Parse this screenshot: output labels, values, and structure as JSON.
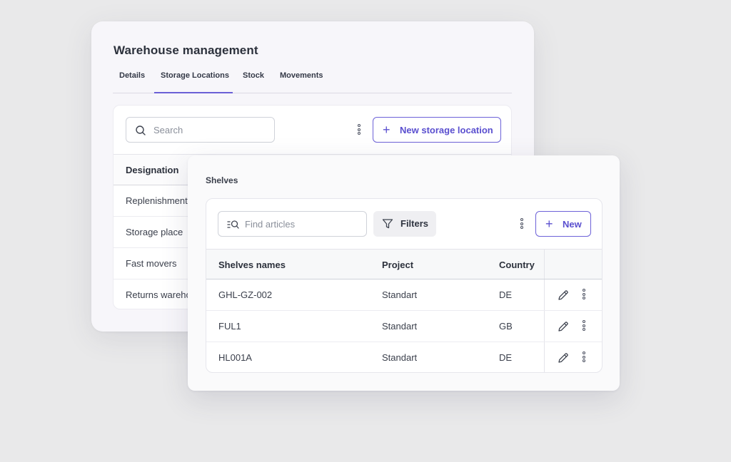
{
  "window": {
    "title": "Warehouse management",
    "tabs": [
      {
        "label": "Details"
      },
      {
        "label": "Storage Locations",
        "active": true
      },
      {
        "label": "Stock"
      },
      {
        "label": "Movements"
      }
    ],
    "search_placeholder": "Search",
    "new_location_label": "New storage location",
    "table": {
      "header": "Designation",
      "rows": [
        "Replenishment",
        "Storage place",
        "Fast movers",
        "Returns wareho"
      ]
    }
  },
  "shelves": {
    "title": "Shelves",
    "search_placeholder": "Find articles",
    "filters_label": "Filters",
    "new_label": "New",
    "columns": [
      "Shelves names",
      "Project",
      "Country"
    ],
    "rows": [
      {
        "name": "GHL-GZ-002",
        "project": "Standart",
        "country": "DE"
      },
      {
        "name": "FUL1",
        "project": "Standart",
        "country": "GB"
      },
      {
        "name": "HL001A",
        "project": "Standart",
        "country": "DE"
      }
    ]
  },
  "colors": {
    "accent": "#6b60d6",
    "background": "#e9e9ea"
  },
  "icons": [
    "search-icon",
    "plus-icon",
    "kebab-icon",
    "find-articles-icon",
    "filter-icon",
    "pencil-icon"
  ]
}
